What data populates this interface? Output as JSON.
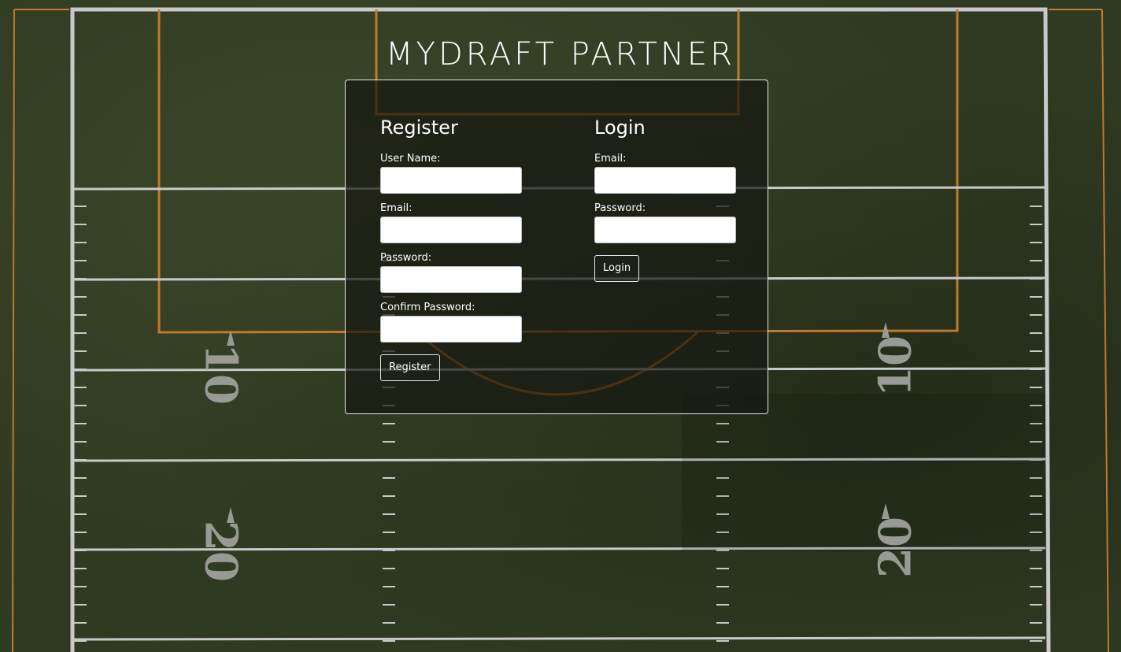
{
  "app": {
    "title": "MYDRAFT PARTNER"
  },
  "background": {
    "description_icon": "football-field",
    "yard_numbers": [
      "10",
      "20",
      "10",
      "20"
    ]
  },
  "register": {
    "heading": "Register",
    "username_label": "User Name:",
    "username_value": "",
    "email_label": "Email:",
    "email_value": "",
    "password_label": "Password:",
    "password_value": "",
    "confirm_label": "Confirm Password:",
    "confirm_value": "",
    "button_label": "Register"
  },
  "login": {
    "heading": "Login",
    "email_label": "Email:",
    "email_value": "",
    "password_label": "Password:",
    "password_value": "",
    "button_label": "Login"
  },
  "colors": {
    "field_green": "#2f3a22",
    "line_white": "#c9c9c9",
    "line_orange": "#c07a2a",
    "card_bg": "rgba(22,24,16,0.72)",
    "text": "#ffffff"
  }
}
